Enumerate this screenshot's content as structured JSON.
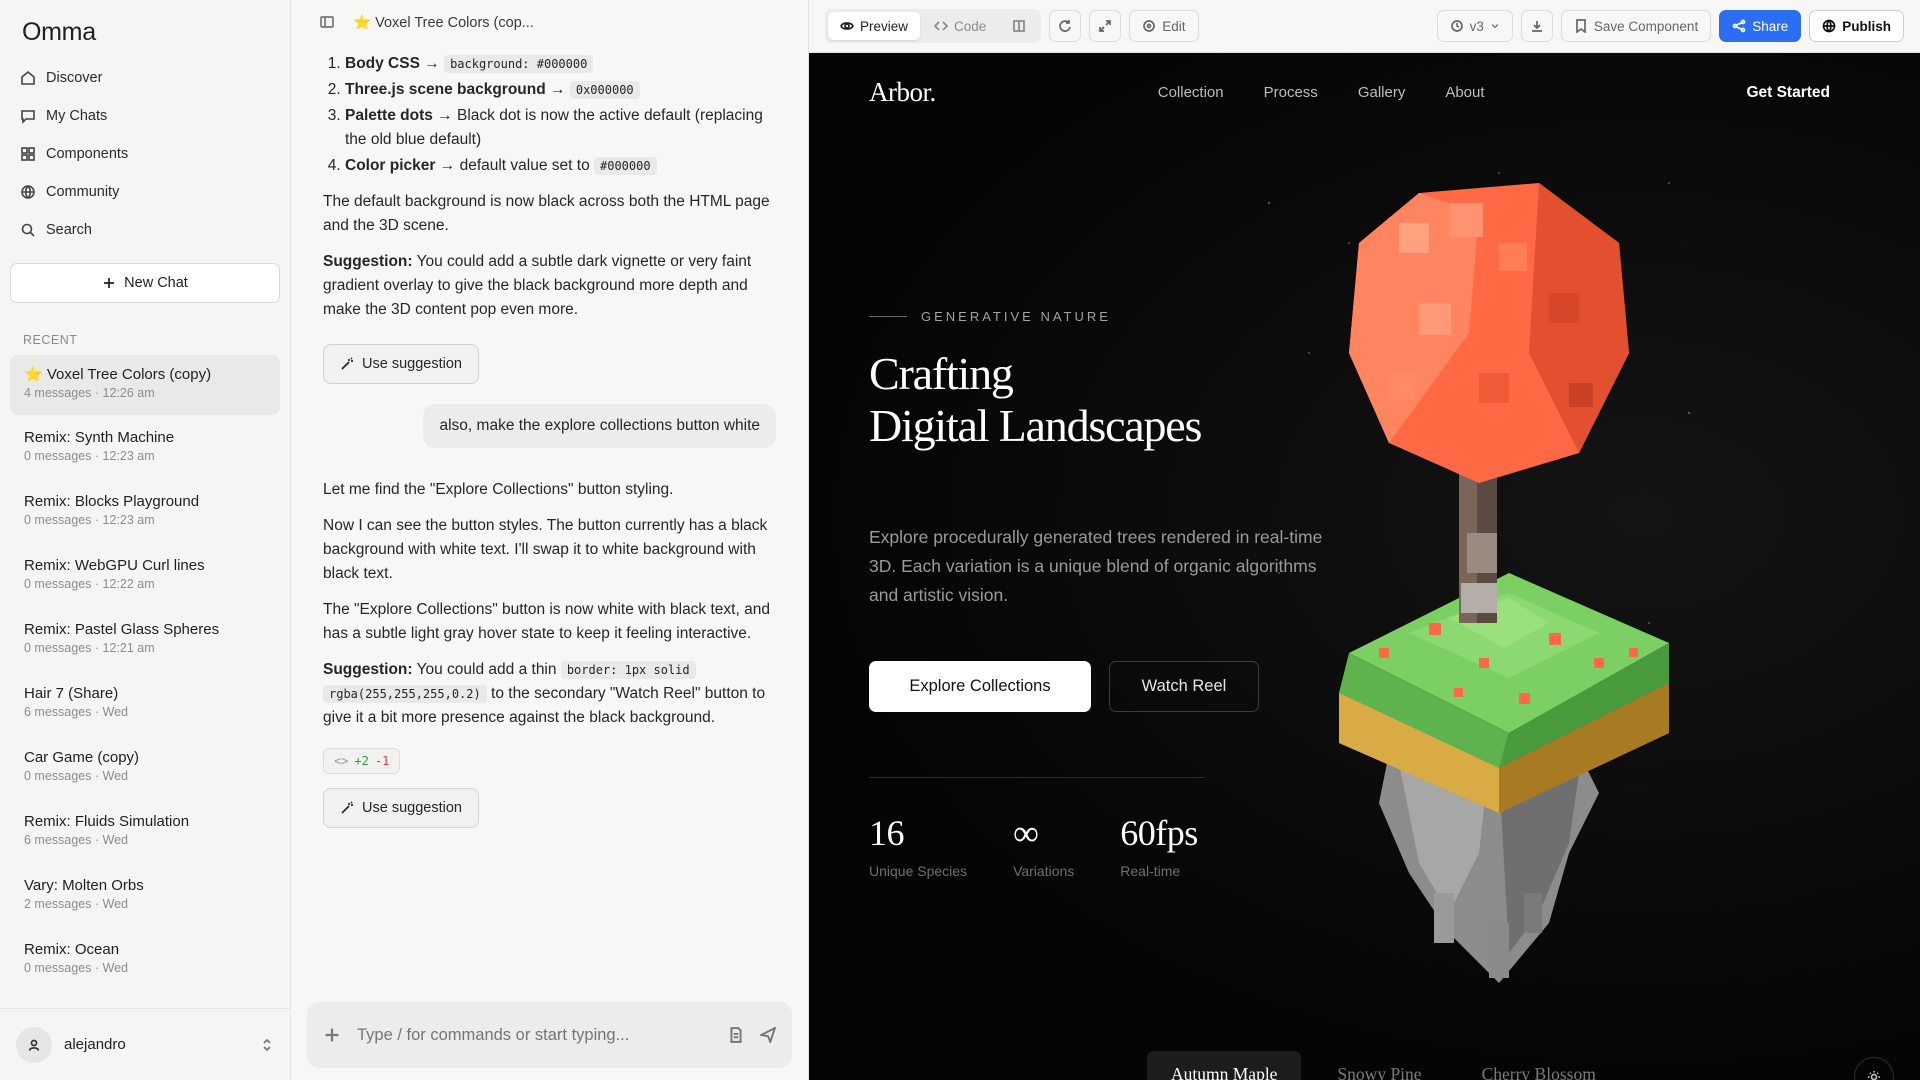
{
  "sidebar": {
    "brand": "Omma",
    "nav": [
      {
        "label": "Discover",
        "icon": "compass-icon"
      },
      {
        "label": "My Chats",
        "icon": "chat-bubble-icon"
      },
      {
        "label": "Components",
        "icon": "grid-icon"
      },
      {
        "label": "Community",
        "icon": "globe-icon"
      },
      {
        "label": "Search",
        "icon": "search-icon"
      }
    ],
    "new_chat": "New Chat",
    "recent_label": "RECENT",
    "chats": [
      {
        "title": "⭐ Voxel Tree Colors (copy)",
        "meta": "4 messages · 12:26 am"
      },
      {
        "title": "Remix: Synth Machine",
        "meta": "0 messages · 12:23 am"
      },
      {
        "title": "Remix: Blocks Playground",
        "meta": "0 messages · 12:23 am"
      },
      {
        "title": "Remix: WebGPU Curl lines",
        "meta": "0 messages · 12:22 am"
      },
      {
        "title": "Remix: Pastel Glass Spheres",
        "meta": "0 messages · 12:21 am"
      },
      {
        "title": "Hair 7 (Share)",
        "meta": "6 messages · Wed"
      },
      {
        "title": "Car Game (copy)",
        "meta": "0 messages · Wed"
      },
      {
        "title": "Remix: Fluids Simulation",
        "meta": "6 messages · Wed"
      },
      {
        "title": "Vary: Molten Orbs",
        "meta": "2 messages · Wed"
      },
      {
        "title": "Remix: Ocean",
        "meta": "0 messages · Wed"
      }
    ],
    "user": "alejandro"
  },
  "chat": {
    "header_title": "⭐ Voxel Tree Colors (cop...",
    "steps": [
      {
        "bold": "Body CSS",
        "arrow": " → ",
        "code": "background: #000000",
        "tail": ""
      },
      {
        "bold": "Three.js scene background",
        "arrow": " → ",
        "code": "0x000000",
        "tail": ""
      },
      {
        "bold": "Palette dots",
        "arrow": " → ",
        "code": "",
        "tail": "Black dot is now the active default (replacing the old blue default)"
      },
      {
        "bold": "Color picker",
        "arrow": " → ",
        "code": "#000000",
        "tail": "default value set to "
      }
    ],
    "para1": "The default background is now black across both the HTML page and the 3D scene.",
    "sugg1_label": "Suggestion:",
    "sugg1_text": " You could add a subtle dark vignette or very faint gradient overlay to give the black background more depth and make the 3D content pop even more.",
    "use_suggestion": "Use suggestion",
    "user_message": "also, make the explore collections button white",
    "para2": "Let me find the \"Explore Collections\" button styling.",
    "para3": "Now I can see the button styles. The button currently has a black background with white text. I'll swap it to white background with black text.",
    "para4": "The \"Explore Collections\" button is now white with black text, and has a subtle light gray hover state to keep it feeling interactive.",
    "sugg2_label": "Suggestion:",
    "sugg2_pre": " You could add a thin ",
    "sugg2_code1": "border: 1px solid",
    "sugg2_code2": "rgba(255,255,255,0.2)",
    "sugg2_post": " to the secondary \"Watch Reel\" button to give it a bit more presence against the black background.",
    "diff_add": "+2",
    "diff_remove": "-1",
    "composer_placeholder": "Type / for commands or start typing..."
  },
  "toolbar": {
    "preview": "Preview",
    "code": "Code",
    "edit": "Edit",
    "version": "v3",
    "save_component": "Save Component",
    "share": "Share",
    "publish": "Publish"
  },
  "site": {
    "logo": "Arbor.",
    "menu": [
      "Collection",
      "Process",
      "Gallery",
      "About"
    ],
    "cta": "Get Started",
    "eyebrow": "GENERATIVE NATURE",
    "title_line1": "Crafting",
    "title_line2": "Digital Landscapes",
    "description": "Explore procedurally generated trees rendered in real-time 3D. Each variation is a unique blend of organic algorithms and artistic vision.",
    "primary_button": "Explore Collections",
    "secondary_button": "Watch Reel",
    "stats": [
      {
        "value": "16",
        "label": "Unique Species"
      },
      {
        "value": "∞",
        "label": "Variations"
      },
      {
        "value": "60fps",
        "label": "Real-time"
      }
    ],
    "variants": [
      "Autumn Maple",
      "Snowy Pine",
      "Cherry Blossom"
    ],
    "active_variant": "Autumn Maple"
  },
  "colors": {
    "accent_blue": "#2b6ef3",
    "foliage_orange": "#ff6a45",
    "grass_green": "#6dc65c",
    "soil_gold": "#d4a43a",
    "rock_gray": "#a9a9a9"
  }
}
